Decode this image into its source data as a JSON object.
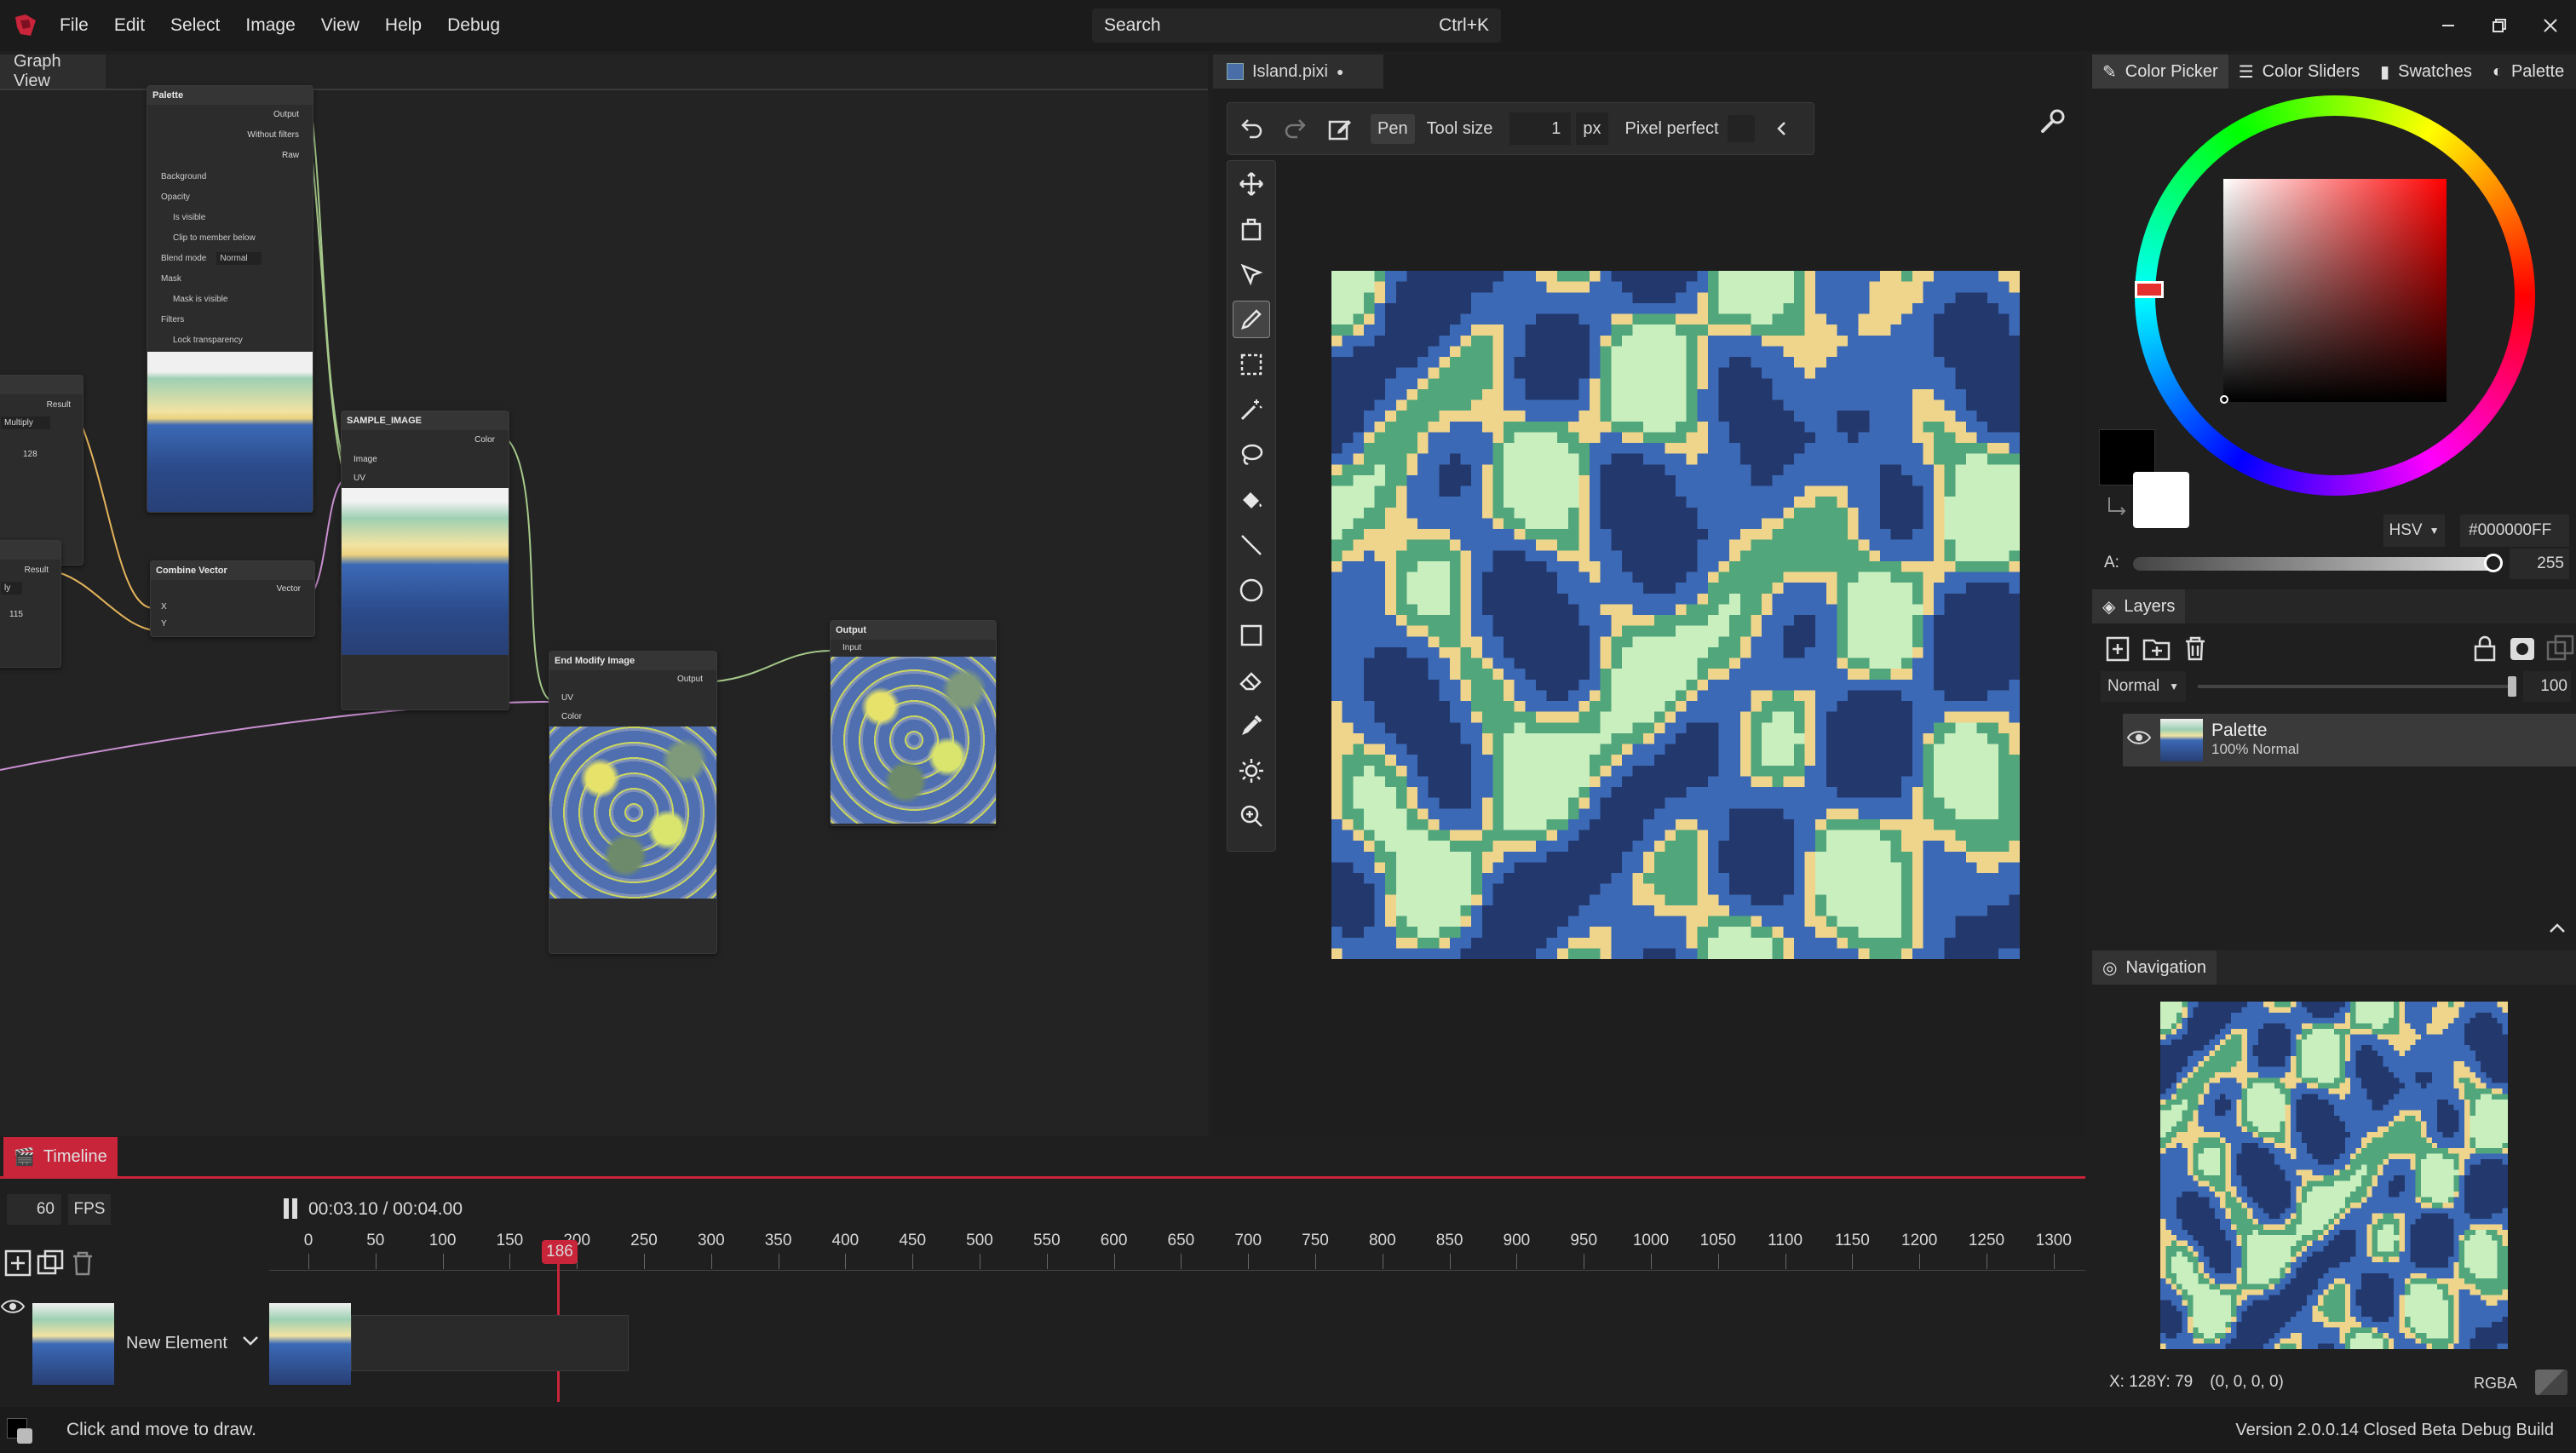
{
  "menubar": {
    "items": [
      "File",
      "Edit",
      "Select",
      "Image",
      "View",
      "Help",
      "Debug"
    ],
    "search_placeholder": "Search",
    "search_shortcut": "Ctrl+K"
  },
  "graph_view": {
    "tab_label": "Graph View",
    "nodes": {
      "palette": {
        "title": "Palette",
        "outputs": [
          "Output",
          "Without filters",
          "Raw"
        ],
        "params": [
          "Background",
          "Opacity",
          "Is visible",
          "Clip to member below",
          "Blend mode",
          "Mask",
          "Mask is visible",
          "Filters",
          "Lock transparency"
        ],
        "blend_value": "Normal"
      },
      "sample_image": {
        "title": "SAMPLE_IMAGE",
        "output": "Color",
        "inputs": [
          "Image",
          "UV"
        ]
      },
      "combine_vector": {
        "title": "Combine Vector",
        "output": "Vector",
        "inputs": [
          "X",
          "Y"
        ]
      },
      "end_modify": {
        "title": "End Modify Image",
        "output": "Output",
        "inputs": [
          "UV",
          "Color"
        ]
      },
      "output": {
        "title": "Output",
        "input": "Input"
      },
      "left_a": {
        "output": "Result",
        "dropdown": "Multiply",
        "value": "128"
      },
      "left_b": {
        "output": "Result",
        "dropdown": "ly",
        "value": "115"
      }
    }
  },
  "document": {
    "tab_label": "Island.pixi",
    "modified_marker": "●",
    "toolbar": {
      "pen_label": "Pen",
      "tool_size_label": "Tool size",
      "tool_size_value": "1",
      "unit": "px",
      "pixel_perfect_label": "Pixel perfect"
    },
    "tools": [
      "move-icon",
      "rotate-icon",
      "select-arrow-icon",
      "pen-icon",
      "rect-select-icon",
      "magic-wand-icon",
      "lasso-icon",
      "bucket-icon",
      "line-icon",
      "ellipse-icon",
      "rectangle-icon",
      "eraser-icon",
      "eyedropper-icon",
      "brightness-icon",
      "zoom-icon"
    ]
  },
  "color_panel": {
    "tabs": [
      "Color Picker",
      "Color Sliders",
      "Swatches",
      "Palette"
    ],
    "mode": "HSV",
    "hex": "#000000FF",
    "alpha_label": "A:",
    "alpha_value": "255",
    "primary_color": "#000000",
    "secondary_color": "#ffffff"
  },
  "layers_panel": {
    "title": "Layers",
    "blend_mode": "Normal",
    "opacity": "100",
    "layers": [
      {
        "name": "Palette",
        "info": "100% Normal"
      }
    ]
  },
  "navigation_panel": {
    "title": "Navigation",
    "coords": "X: 128Y: 79",
    "pixel_value": "(0, 0, 0, 0)",
    "format": "RGBA"
  },
  "timeline": {
    "title": "Timeline",
    "fps_value": "60",
    "fps_label": "FPS",
    "time": "00:03.10 / 00:04.00",
    "ticks": [
      "0",
      "50",
      "100",
      "150",
      "200",
      "250",
      "300",
      "350",
      "400",
      "450",
      "500",
      "550",
      "600",
      "650",
      "700",
      "750",
      "800",
      "850",
      "900",
      "950",
      "1000",
      "1050",
      "1100",
      "1150",
      "1200",
      "1250",
      "1300"
    ],
    "current_frame": "186",
    "element_name": "New Element"
  },
  "status": {
    "hint": "Click and move to draw.",
    "version": "Version 2.0.0.14 Closed Beta Debug Build"
  },
  "colors": {
    "accent": "#c8243a",
    "island_dark": "#23396d",
    "island_blue": "#3c69b5",
    "island_sand": "#efd58c",
    "island_green": "#52a67b",
    "island_light": "#c9efbf"
  }
}
